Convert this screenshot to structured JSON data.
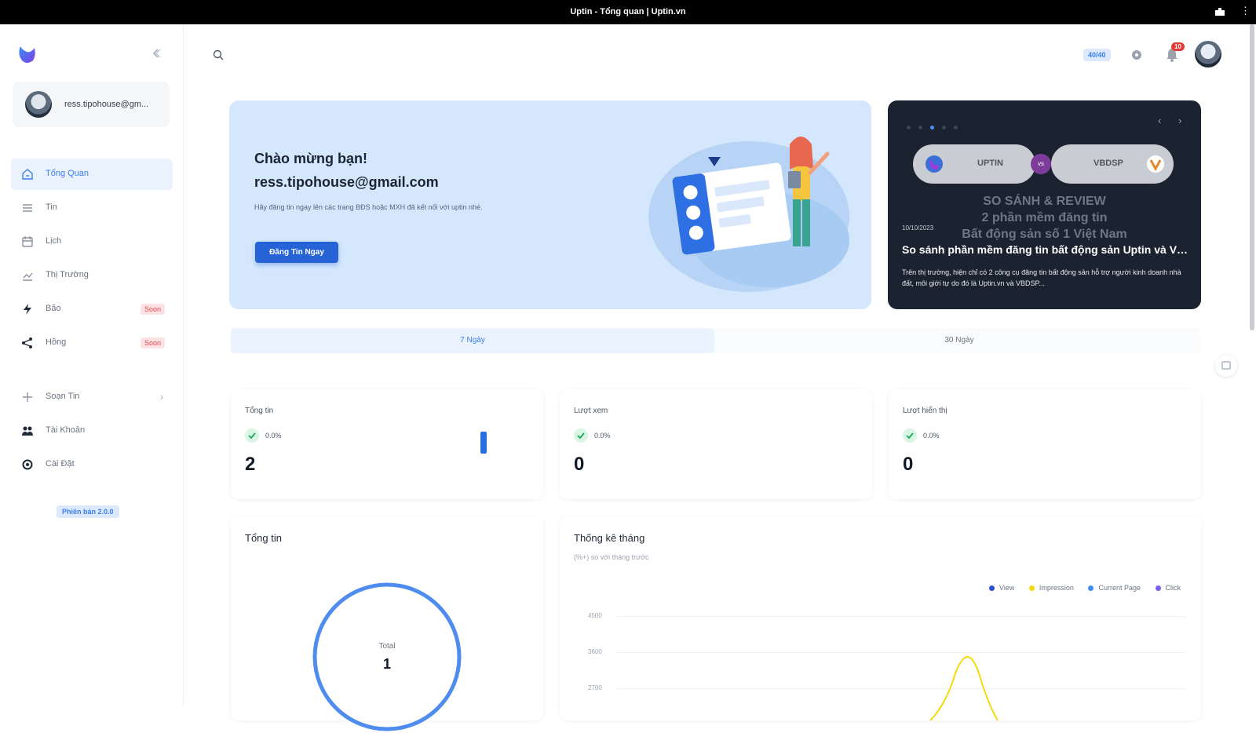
{
  "window": {
    "title": "Uptin - Tổng quan | Uptin.vn"
  },
  "sidebar": {
    "user_email": "ress.tipohouse@gm...",
    "items": [
      {
        "label": "Tổng Quan",
        "icon": "home-icon",
        "active": true
      },
      {
        "label": "Tin",
        "icon": "list-icon"
      },
      {
        "label": "Lịch",
        "icon": "calendar-icon"
      },
      {
        "label": "Thị Trường",
        "icon": "chart-icon"
      },
      {
        "label": "Bão",
        "icon": "lightning-icon",
        "badge": "Soon"
      },
      {
        "label": "Hồng",
        "icon": "share-icon",
        "badge": "Soon"
      },
      {
        "label": "Soạn Tin",
        "icon": "plus-icon"
      },
      {
        "label": "Tài Khoản",
        "icon": "users-icon"
      },
      {
        "label": "Cài Đặt",
        "icon": "gear-icon"
      }
    ],
    "version": "Phiên bản 2.0.0"
  },
  "topbar": {
    "credit": "40/40",
    "notifications": "10"
  },
  "hero": {
    "greeting": "Chào mừng bạn!",
    "email": "ress.tipohouse@gmail.com",
    "description": "Hãy đăng tin ngay lên các trang BĐS hoặc MXH đã kết nối với uptin nhé.",
    "cta": "Đăng Tin Ngay"
  },
  "news": {
    "left_brand": "UPTIN",
    "vs": "vs",
    "right_brand": "VBDSP",
    "headline_1": "SO SÁNH & REVIEW",
    "headline_2": "2 phần mềm đăng tin",
    "headline_3": "Bất động sản số 1 Việt Nam",
    "date": "10/10/2023",
    "title": "So sánh phần mềm đăng tin bất động sản Uptin và VBDSP",
    "summary": "Trên thị trường, hiện chỉ có 2 công cụ đăng tin bất động sản hỗ trợ người kinh doanh nhà đất, môi giới tự do đó là Uptin.vn và VBDSP..."
  },
  "range_tabs": {
    "first": "7 Ngày",
    "second": "30 Ngày"
  },
  "stats": [
    {
      "label": "Tổng tin",
      "pct": "0.0%",
      "value": "2"
    },
    {
      "label": "Lượt xem",
      "pct": "0.0%",
      "value": "0"
    },
    {
      "label": "Lượt hiển thị",
      "pct": "0.0%",
      "value": "0"
    }
  ],
  "total_card": {
    "title": "Tổng tin",
    "center_label": "Total",
    "center_value": "1"
  },
  "monthly": {
    "title": "Thống kê tháng",
    "subtitle": "(%+) so với tháng trước",
    "legend": [
      "View",
      "Impression",
      "Current Page",
      "Click"
    ],
    "yticks": [
      "4500",
      "3600",
      "2700"
    ]
  },
  "chart_data": {
    "type": "line",
    "title": "Thống kê tháng",
    "series": [
      {
        "name": "View",
        "color": "#2a4fd6"
      },
      {
        "name": "Impression",
        "color": "#f5d90a"
      },
      {
        "name": "Current Page",
        "color": "#3a8ef6"
      },
      {
        "name": "Click",
        "color": "#7b5cf0"
      }
    ],
    "ylim": [
      0,
      4500
    ],
    "yticks": [
      2700,
      3600,
      4500
    ]
  },
  "colors": {
    "primary": "#2563d6",
    "accent": "#3a7ef0",
    "hero_bg": "#d4e7fc",
    "news_bg": "#1b2230"
  }
}
